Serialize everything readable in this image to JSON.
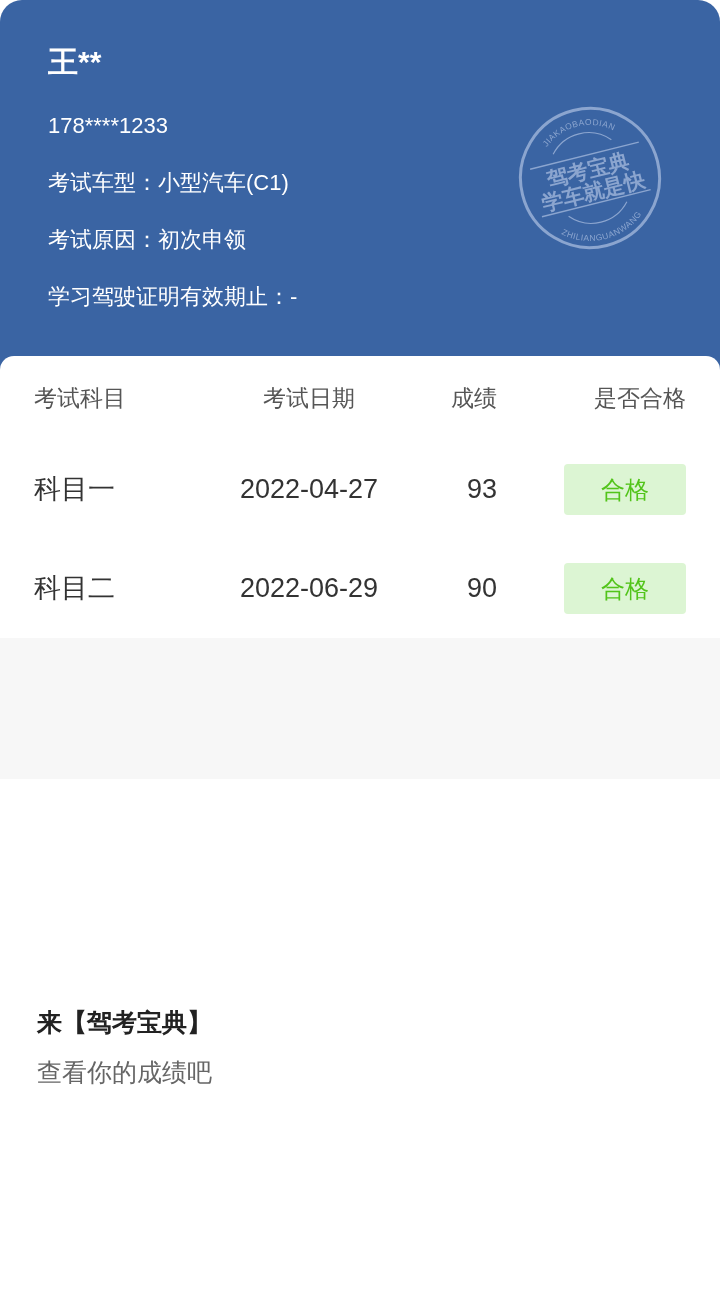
{
  "profile": {
    "name": "王**",
    "phone": "178****1233",
    "details": [
      "考试车型：小型汽车(C1)",
      "考试原因：初次申领",
      "学习驾驶证明有效期止：-"
    ]
  },
  "stamp": {
    "top_text": "JIAKAOBAODIAN",
    "line_1": "驾考宝典",
    "line_2": "学车就是快",
    "bottom_text": "ZHILIANGUANWANG"
  },
  "table": {
    "columns": [
      "考试科目",
      "考试日期",
      "成绩",
      "是否合格"
    ],
    "rows": [
      {
        "subject": "科目一",
        "date": "2022-04-27",
        "score": "93",
        "result": "合格"
      },
      {
        "subject": "科目二",
        "date": "2022-06-29",
        "score": "90",
        "result": "合格"
      }
    ]
  },
  "footer": {
    "title": "来【驾考宝典】",
    "subtitle": "查看你的成绩吧"
  }
}
